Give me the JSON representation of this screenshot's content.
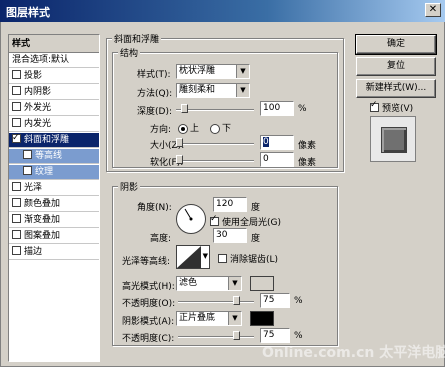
{
  "window": {
    "title": "图层样式",
    "close": "✕"
  },
  "left_panel": {
    "header": "样式",
    "items": [
      {
        "label": "混合选项:默认"
      },
      {
        "label": "投影"
      },
      {
        "label": "内阴影"
      },
      {
        "label": "外发光"
      },
      {
        "label": "内发光"
      },
      {
        "label": "斜面和浮雕"
      },
      {
        "label": "等高线"
      },
      {
        "label": "纹理"
      },
      {
        "label": "光泽"
      },
      {
        "label": "颜色叠加"
      },
      {
        "label": "渐变叠加"
      },
      {
        "label": "图案叠加"
      },
      {
        "label": "描边"
      }
    ]
  },
  "bevel": {
    "section_title": "斜面和浮雕",
    "structure_title": "结构",
    "style_label": "样式(T):",
    "style_value": "枕状浮雕",
    "technique_label": "方法(Q):",
    "technique_value": "雕刻柔和",
    "depth_label": "深度(D):",
    "depth_value": "100",
    "depth_unit": "%",
    "direction_label": "方向:",
    "dir_up": "上",
    "dir_down": "下",
    "size_label": "大小(Z):",
    "size_value": "0",
    "size_unit": "像素",
    "soften_label": "软化(F):",
    "soften_value": "0",
    "soften_unit": "像素"
  },
  "shading": {
    "title": "阴影",
    "angle_label": "角度(N):",
    "angle_value": "120",
    "angle_unit": "度",
    "global_light_label": "使用全局光(G)",
    "altitude_label": "高度:",
    "altitude_value": "30",
    "altitude_unit": "度",
    "gloss_label": "光泽等高线:",
    "antialias_label": "消除锯齿(L)",
    "highlight_mode_label": "高光模式(H):",
    "highlight_mode_value": "滤色",
    "highlight_opacity_label": "不透明度(O):",
    "highlight_opacity_value": "75",
    "shadow_mode_label": "阴影模式(A):",
    "shadow_mode_value": "正片叠底",
    "shadow_opacity_label": "不透明度(C):",
    "shadow_opacity_value": "75",
    "percent": "%"
  },
  "buttons": {
    "ok": "确定",
    "reset": "复位",
    "new_style": "新建样式(W)...",
    "preview": "预览(V)"
  },
  "watermark": "Online.com.cn 太平洋电脑网",
  "colors": {
    "title_bar": "#0a246a",
    "selection": "#0a246a",
    "highlight_swatch": "#ffffff",
    "shadow_swatch": "#000000"
  },
  "slider_levels": {
    "depth": 0.1,
    "size": 0.0,
    "soften": 0.0,
    "highlight_opacity": 0.75,
    "shadow_opacity": 0.75
  }
}
